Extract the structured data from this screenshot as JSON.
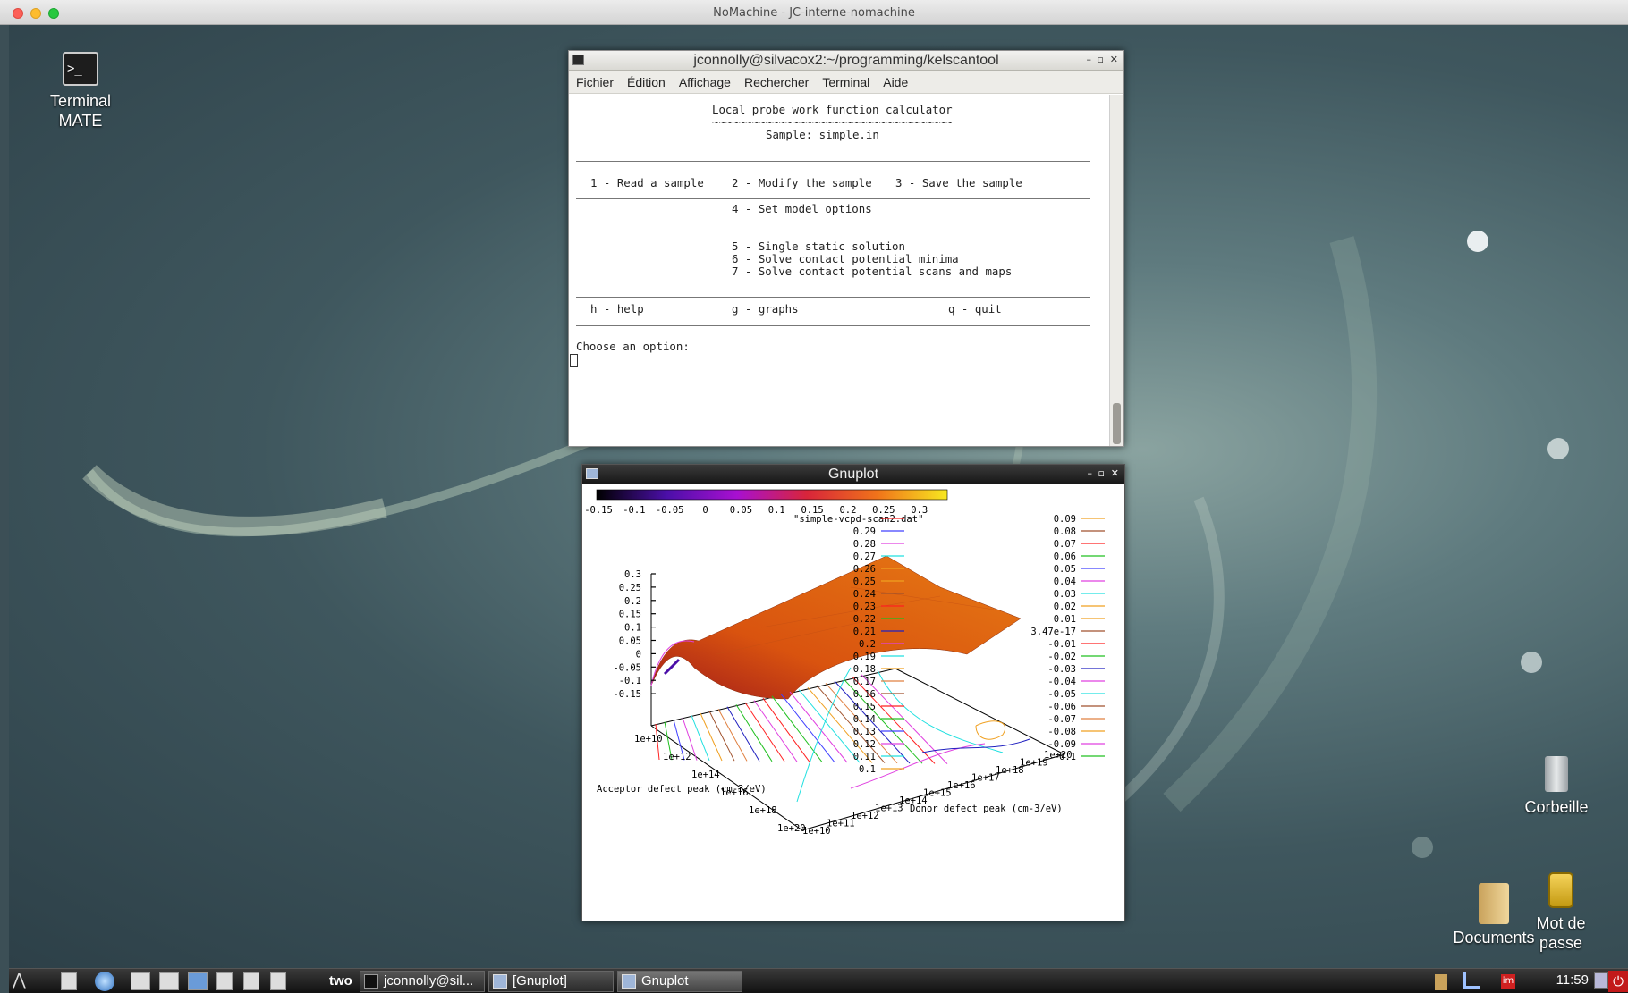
{
  "mac_window": {
    "title": "NoMachine - JC-interne-nomachine"
  },
  "desktop": {
    "icons": [
      {
        "line1": "Terminal",
        "line2": "MATE"
      },
      {
        "line1": "Corbeille",
        "line2": ""
      },
      {
        "line1": "Documents",
        "line2": ""
      },
      {
        "line1": "Mot de",
        "line2": "passe"
      }
    ]
  },
  "terminal": {
    "title": "jconnolly@silvacox2:~/programming/kelscantool",
    "menu": [
      "Fichier",
      "Édition",
      "Affichage",
      "Rechercher",
      "Terminal",
      "Aide"
    ],
    "heading": "Local probe work function calculator",
    "underline": "~~~~~~~~~~~~~~~~~~~~~~~~~~~~~~~~~~~~",
    "sample": "Sample: simple.in",
    "opt1": "1 - Read a sample",
    "opt2": "2 - Modify the sample",
    "opt3": "3 - Save the sample",
    "opt4": "4 - Set model options",
    "opt5": "5 - Single static solution",
    "opt6": "6 - Solve contact potential minima",
    "opt7": "7 - Solve contact potential scans and maps",
    "help": "h - help",
    "graphs": "g - graphs",
    "quit": "q - quit",
    "prompt": "Choose an option:"
  },
  "gnuplot": {
    "title": "Gnuplot",
    "colorbar_ticks": [
      "-0.15",
      "-0.1",
      "-0.05",
      "0",
      "0.05",
      "0.1",
      "0.15",
      "0.2",
      "0.25",
      "0.3"
    ],
    "series_name": "\"simple-vcpd-scan2.dat\"",
    "legend_mid": [
      {
        "label": "0.29",
        "color": "#4040ff"
      },
      {
        "label": "0.28",
        "color": "#e040e0"
      },
      {
        "label": "0.27",
        "color": "#20e0e0"
      },
      {
        "label": "0.26",
        "color": "#f0a020"
      },
      {
        "label": "0.25",
        "color": "#f0a020"
      },
      {
        "label": "0.24",
        "color": "#a0522d"
      },
      {
        "label": "0.23",
        "color": "#ff2020"
      },
      {
        "label": "0.22",
        "color": "#20c020"
      },
      {
        "label": "0.21",
        "color": "#2020c0"
      },
      {
        "label": "0.2",
        "color": "#e040e0"
      },
      {
        "label": "0.19",
        "color": "#20e0e0"
      },
      {
        "label": "0.18",
        "color": "#f0a020"
      },
      {
        "label": "0.17",
        "color": "#e08040"
      },
      {
        "label": "0.16",
        "color": "#a0522d"
      },
      {
        "label": "0.15",
        "color": "#ff2020"
      },
      {
        "label": "0.14",
        "color": "#20c020"
      },
      {
        "label": "0.13",
        "color": "#4040ff"
      },
      {
        "label": "0.12",
        "color": "#e040e0"
      },
      {
        "label": "0.11",
        "color": "#20e0e0"
      },
      {
        "label": "0.1",
        "color": "#f0a020"
      }
    ],
    "legend_right": [
      {
        "label": "0.09",
        "color": "#f0a020"
      },
      {
        "label": "0.08",
        "color": "#a0522d"
      },
      {
        "label": "0.07",
        "color": "#ff2020"
      },
      {
        "label": "0.06",
        "color": "#20c020"
      },
      {
        "label": "0.05",
        "color": "#4040ff"
      },
      {
        "label": "0.04",
        "color": "#e040e0"
      },
      {
        "label": "0.03",
        "color": "#20e0e0"
      },
      {
        "label": "0.02",
        "color": "#f0a020"
      },
      {
        "label": "0.01",
        "color": "#f0a020"
      },
      {
        "label": "3.47e-17",
        "color": "#a0522d"
      },
      {
        "label": "-0.01",
        "color": "#ff2020"
      },
      {
        "label": "-0.02",
        "color": "#20c020"
      },
      {
        "label": "-0.03",
        "color": "#2020c0"
      },
      {
        "label": "-0.04",
        "color": "#e040e0"
      },
      {
        "label": "-0.05",
        "color": "#20e0e0"
      },
      {
        "label": "-0.06",
        "color": "#a0522d"
      },
      {
        "label": "-0.07",
        "color": "#e08040"
      },
      {
        "label": "-0.08",
        "color": "#f0a020"
      },
      {
        "label": "-0.09",
        "color": "#e040e0"
      },
      {
        "label": "-0.1",
        "color": "#20c020"
      }
    ],
    "z_ticks": [
      "0.3",
      "0.25",
      "0.2",
      "0.15",
      "0.1",
      "0.05",
      "0",
      "-0.05",
      "-0.1",
      "-0.15"
    ],
    "acceptor_ticks": [
      "1e+10",
      "1e+12",
      "1e+14",
      "1e+16",
      "1e+18",
      "1e+20"
    ],
    "donor_ticks": [
      "1e+10",
      "1e+11",
      "1e+12",
      "1e+13",
      "1e+14",
      "1e+15",
      "1e+16",
      "1e+17",
      "1e+18",
      "1e+19",
      "1e+20"
    ],
    "acceptor_label": "Acceptor defect peak (cm-3/eV)",
    "donor_label": "Donor defect peak (cm-3/eV)"
  },
  "taskbar": {
    "workspace": "two",
    "windows": [
      "jconnolly@sil...",
      "[Gnuplot]",
      "Gnuplot"
    ],
    "clock": "11:59"
  }
}
